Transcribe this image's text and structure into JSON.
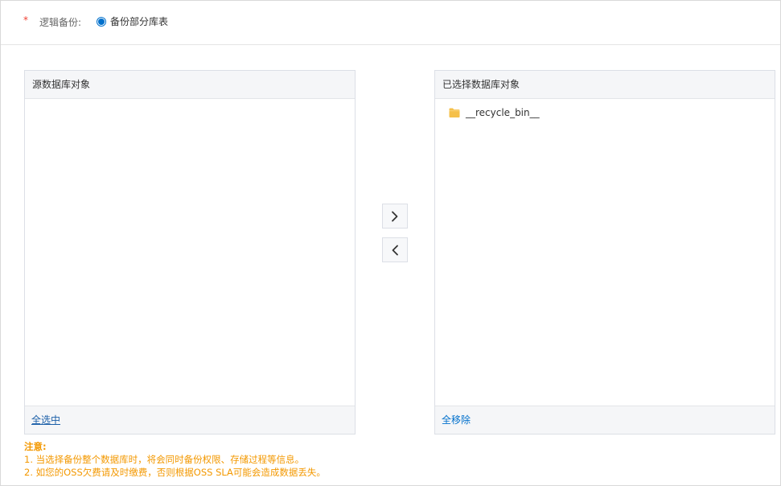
{
  "form": {
    "required_mark": "*",
    "label": "逻辑备份:",
    "radio_option": "备份部分库表",
    "radio_selected": true
  },
  "source_panel": {
    "title": "源数据库对象",
    "items": [],
    "footer_action": "全选中"
  },
  "target_panel": {
    "title": "已选择数据库对象",
    "items": [
      {
        "label": "__recycle_bin__",
        "icon": "folder-icon"
      }
    ],
    "footer_action": "全移除"
  },
  "buttons": {
    "move_right_icon": "chevron-right-icon",
    "move_left_icon": "chevron-left-icon"
  },
  "notes": {
    "title": "注意:",
    "lines": [
      "1. 当选择备份整个数据库时，将会同时备份权限、存储过程等信息。",
      "2. 如您的OSS欠费请及时缴费，否则根据OSS SLA可能会造成数据丢失。"
    ]
  },
  "colors": {
    "accent": "#0070cc",
    "required": "#f04134",
    "warning": "#f39800",
    "folder": "#f5c04a"
  }
}
